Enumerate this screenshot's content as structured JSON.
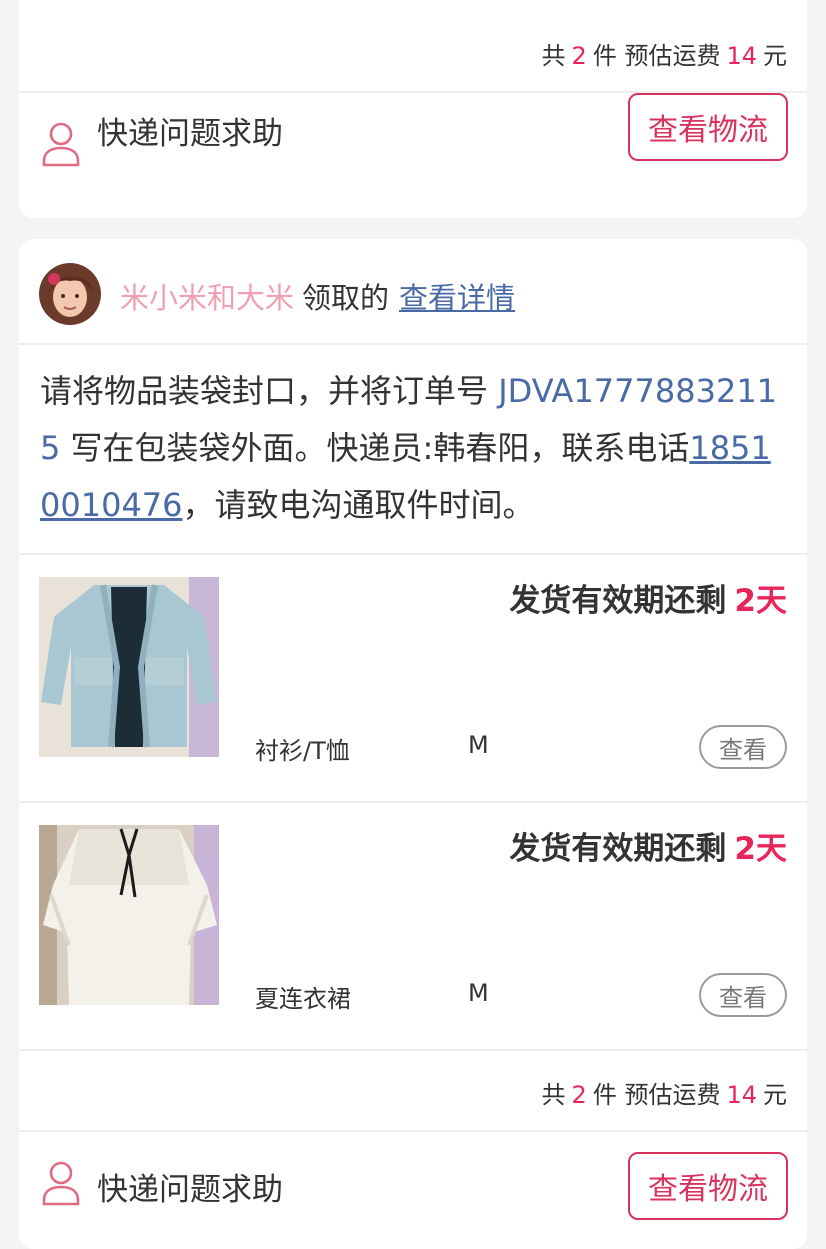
{
  "colors": {
    "accent": "#e8255a",
    "link": "#4a6aa5",
    "claimer_name": "#f0a1b1"
  },
  "top_card": {
    "summary": {
      "prefix": "共",
      "count": "2",
      "unit": "件 预估运费",
      "fee": "14",
      "currency": "元"
    },
    "help": {
      "icon": "user-outline-icon",
      "label": "快递问题求助",
      "button": "查看物流"
    }
  },
  "order_card": {
    "claimer": {
      "name": "米小米和大米",
      "verb": "领取的",
      "details_link": "查看详情",
      "avatar_icon": "avatar-icon"
    },
    "instructions": {
      "before_order": "请将物品装袋封口，并将订单号 ",
      "order_number": "JDVA17778832115",
      "middle": " 写在包装袋外面。快递员:韩春阳，联系电话",
      "phone": "18510010476",
      "after_phone": "，请致电沟通取件时间。"
    },
    "items": [
      {
        "deadline_label": "发货有效期还剩",
        "days": "2天",
        "category": "衬衫/T恤",
        "size": "M",
        "view_button": "查看",
        "image_icon": "cardigan-photo"
      },
      {
        "deadline_label": "发货有效期还剩",
        "days": "2天",
        "category": "夏连衣裙",
        "size": "M",
        "view_button": "查看",
        "image_icon": "dress-photo"
      }
    ],
    "summary": {
      "prefix": "共",
      "count": "2",
      "unit": "件 预估运费",
      "fee": "14",
      "currency": "元"
    },
    "help": {
      "icon": "user-outline-icon",
      "label": "快递问题求助",
      "button": "查看物流"
    }
  }
}
